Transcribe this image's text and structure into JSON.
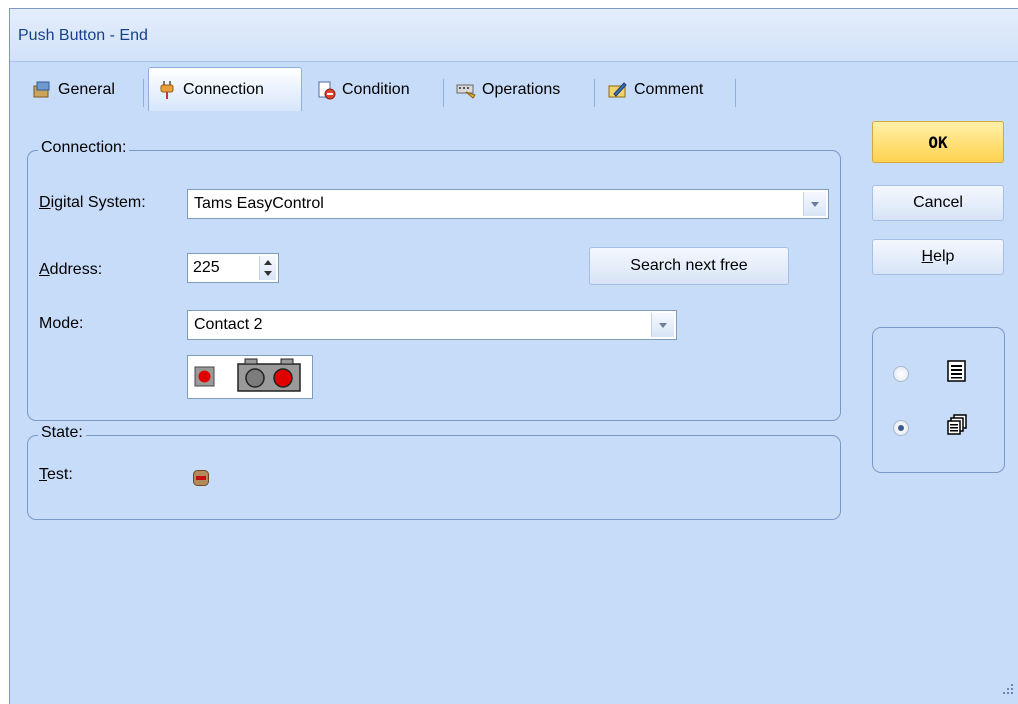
{
  "window": {
    "title": "Push Button - End"
  },
  "tabs": [
    {
      "label": "General",
      "icon": "general-icon"
    },
    {
      "label": "Connection",
      "icon": "plug-icon"
    },
    {
      "label": "Condition",
      "icon": "condition-icon"
    },
    {
      "label": "Operations",
      "icon": "operations-icon"
    },
    {
      "label": "Comment",
      "icon": "comment-icon"
    }
  ],
  "connection": {
    "legend": "Connection:",
    "digital_system_label": "Digital System:",
    "digital_system_value": "Tams EasyControl",
    "address_label": "Address:",
    "address_value": "225",
    "search_button": "Search next free",
    "mode_label": "Mode:",
    "mode_value": "Contact 2"
  },
  "state": {
    "legend": "State:",
    "test_label": "Test:"
  },
  "buttons": {
    "ok": "OK",
    "cancel": "Cancel",
    "help": "Help"
  },
  "view_options": [
    {
      "icon": "list-view-icon",
      "checked": false
    },
    {
      "icon": "cascade-view-icon",
      "checked": true
    }
  ],
  "colors": {
    "background": "#c7dcf9",
    "ok_button": "#ffd250",
    "indicator_red": "#e00000"
  }
}
